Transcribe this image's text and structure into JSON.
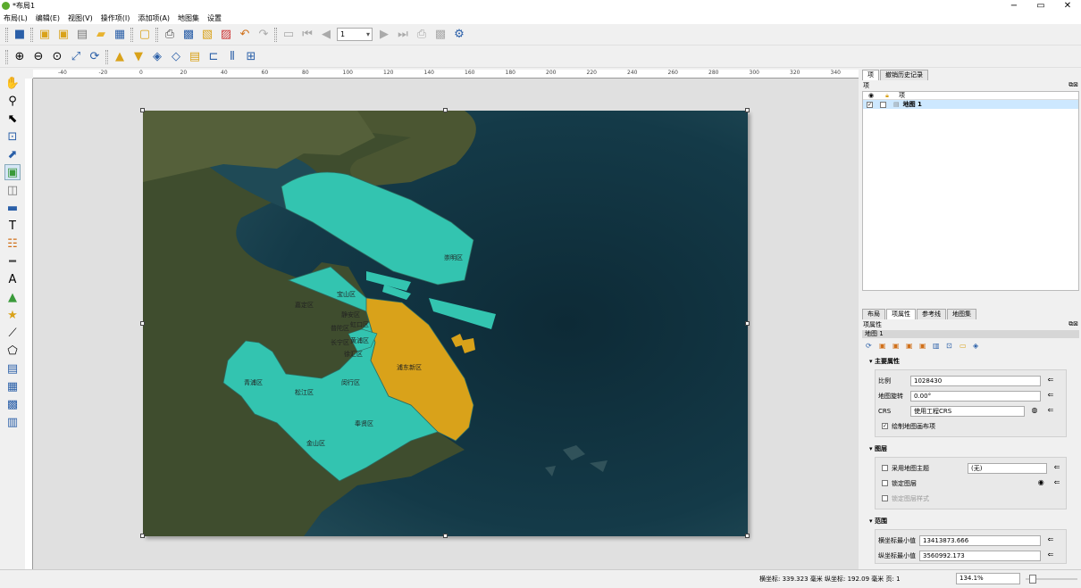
{
  "window": {
    "title": "*布局1",
    "min": "−",
    "max": "▭",
    "close": "✕"
  },
  "menu": [
    "布局(L)",
    "编辑(E)",
    "视图(V)",
    "操作项(I)",
    "添加项(A)",
    "地图集",
    "设置"
  ],
  "toolbar": {
    "page_value": "1"
  },
  "ruler_top_ticks": [
    "-40",
    "-20",
    "0",
    "20",
    "40",
    "60",
    "80",
    "100",
    "120",
    "140",
    "160",
    "180",
    "200",
    "220",
    "240",
    "260",
    "280",
    "300",
    "320",
    "340"
  ],
  "map": {
    "colors": {
      "water": "#10303c",
      "land": "#3b4a2a",
      "districts": "#33c4b0",
      "pudong": "#d9a21a",
      "border": "#2d6b60"
    },
    "labels": {
      "chongming": "崇明区",
      "baoshan": "宝山区",
      "jiading": "嘉定区",
      "jingan": "静安区",
      "putuo": "普陀区",
      "hongkou": "虹口区",
      "changning": "长宁区",
      "huangpu": "黄浦区",
      "xuhui": "徐汇区",
      "pudong": "浦东新区",
      "qingpu": "青浦区",
      "songjiang": "松江区",
      "minhang": "闵行区",
      "fengxian": "奉贤区",
      "jinshan": "金山区"
    }
  },
  "items_panel": {
    "tabs": [
      "项",
      "撤销历史记录"
    ],
    "heading": "项",
    "column": "项",
    "rows": [
      {
        "label": "地图 1",
        "visible_mark": "✓"
      }
    ]
  },
  "props_panel": {
    "tabs": [
      "布局",
      "项属性",
      "参考线",
      "地图集"
    ],
    "heading": "项属性",
    "item_name": "地图 1",
    "main_section": "主要属性",
    "scale_label": "比例",
    "scale_value": "1028430",
    "rotation_label": "地图旋转",
    "rotation_value": "0.00°",
    "crs_label": "CRS",
    "crs_value": "使用工程CRS",
    "draw_items_label": "绘制地图画布项",
    "layers_section": "图层",
    "follow_theme_label": "采用地图主题",
    "theme_value": "(无)",
    "lock_layers_label": "锁定图层",
    "lock_styles_label": "锁定图层样式",
    "extent_section": "范围",
    "xmin_label": "横坐标最小值",
    "xmin_value": "13413873.666",
    "ymin_label": "纵坐标最小值",
    "ymin_value": "3560992.173"
  },
  "status": {
    "coords": "横坐标: 339.323 毫米 纵坐标: 192.09 毫米 页: 1",
    "zoom": "134.1%"
  }
}
